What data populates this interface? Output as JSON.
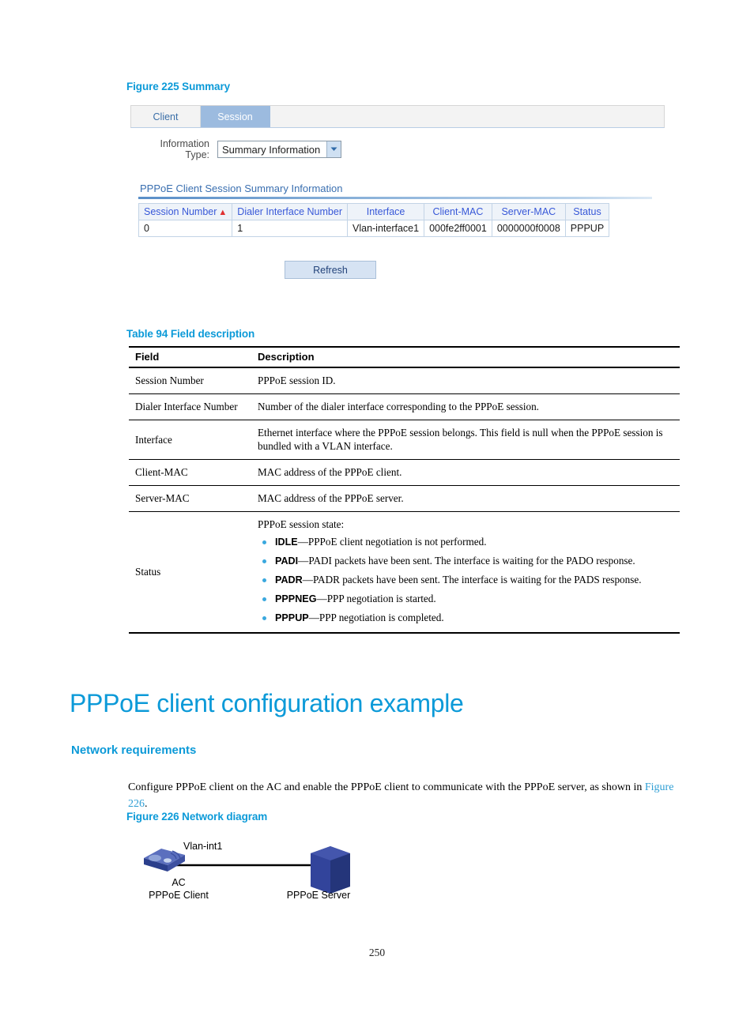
{
  "figure225": {
    "caption": "Figure 225 Summary",
    "ui": {
      "tabs": [
        {
          "label": "Client",
          "selected": false
        },
        {
          "label": "Session",
          "selected": true
        }
      ],
      "form": {
        "info_type_label_line1": "Information",
        "info_type_label_line2": "Type:",
        "info_type_value": "Summary Information",
        "dropdown_icon": "chevron-down-icon"
      },
      "section_title": "PPPoE Client Session Summary Information",
      "grid": {
        "headers": [
          "Session Number",
          "Dialer Interface Number",
          "Interface",
          "Client-MAC",
          "Server-MAC",
          "Status"
        ],
        "sort_column": "Session Number",
        "sort_indicator": "ascending-sort-arrow-icon",
        "rows": [
          [
            "0",
            "1",
            "Vlan-interface1",
            "000fe2ff0001",
            "0000000f0008",
            "PPPUP"
          ]
        ]
      },
      "refresh_label": "Refresh"
    }
  },
  "table94": {
    "caption": "Table 94 Field description",
    "headers": [
      "Field",
      "Description"
    ],
    "rows": [
      {
        "field": "Session Number",
        "description": "PPPoE session ID."
      },
      {
        "field": "Dialer Interface Number",
        "description": "Number of the dialer interface corresponding to the PPPoE session."
      },
      {
        "field": "Interface",
        "description": "Ethernet interface where the PPPoE session belongs. This field is null when the PPPoE session is bundled with a VLAN interface."
      },
      {
        "field": "Client-MAC",
        "description": "MAC address of the PPPoE client."
      },
      {
        "field": "Server-MAC",
        "description": "MAC address of the PPPoE server."
      }
    ],
    "status_row": {
      "field": "Status",
      "intro": "PPPoE session state:",
      "bullets": [
        {
          "term": "IDLE",
          "text": "—PPPoE client negotiation is not performed."
        },
        {
          "term": "PADI",
          "text": "—PADI packets have been sent. The interface is waiting for the PADO response."
        },
        {
          "term": "PADR",
          "text": "—PADR packets have been sent. The interface is waiting for the PADS response."
        },
        {
          "term": "PPPNEG",
          "text": "—PPP negotiation is started."
        },
        {
          "term": "PPPUP",
          "text": "—PPP negotiation is completed."
        }
      ]
    }
  },
  "headings": {
    "h1": "PPPoE client configuration example",
    "h2_network_requirements": "Network requirements"
  },
  "body": {
    "network_requirements_part1": "Configure PPPoE client on the AC and enable the PPPoE client to communicate with the PPPoE server, as shown in ",
    "network_requirements_link": "Figure 226",
    "network_requirements_part2": "."
  },
  "figure226": {
    "caption": "Figure 226 Network diagram",
    "link_label": "Vlan-int1",
    "nodes": [
      {
        "name": "ac-device",
        "label_line1": "AC",
        "label_line2": "PPPoE Client",
        "icon": "wireless-access-controller-icon"
      },
      {
        "name": "server-device",
        "label_line1": "PPPoE Server",
        "label_line2": "",
        "icon": "server-box-icon"
      }
    ]
  },
  "footer": {
    "page_number": "250"
  },
  "colors": {
    "accent_blue": "#0c9ad8",
    "tab_selected": "#9cbbdf",
    "grid_header_text": "#3858d8",
    "sort_arrow_red": "#e03030",
    "bullet_blue": "#3aa8de",
    "device_blue": "#2b3f8c"
  }
}
